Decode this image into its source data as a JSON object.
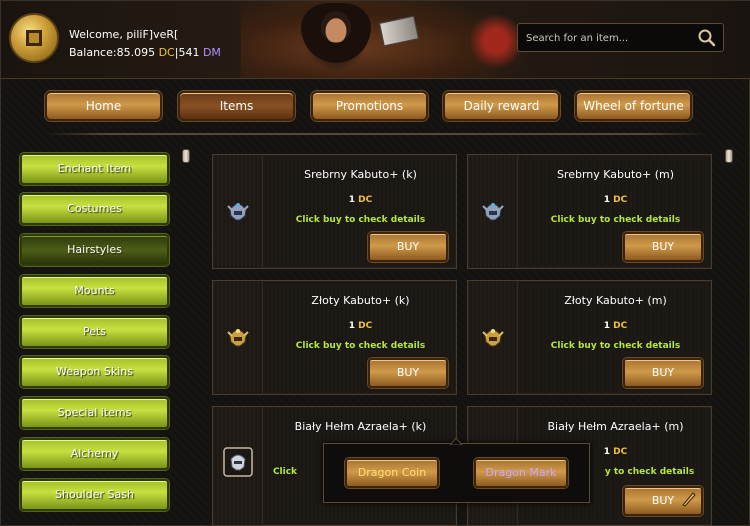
{
  "header": {
    "welcome_prefix": "Welcome, ",
    "username": "piliF]veR[",
    "balance_label": "Balance:",
    "dc_amount": "85.095",
    "dc_unit": "DC",
    "separator": "|",
    "dm_amount": "541",
    "dm_unit": "DM"
  },
  "search": {
    "placeholder": "Search for an item..."
  },
  "nav": {
    "items": [
      {
        "label": "Home"
      },
      {
        "label": "Items"
      },
      {
        "label": "Promotions"
      },
      {
        "label": "Daily reward"
      },
      {
        "label": "Wheel of fortune"
      }
    ],
    "active": "Items"
  },
  "sidebar": {
    "items": [
      {
        "label": "Enchant Item"
      },
      {
        "label": "Costumes"
      },
      {
        "label": "Hairstyles"
      },
      {
        "label": "Mounts"
      },
      {
        "label": "Pets"
      },
      {
        "label": "Weapon Skins"
      },
      {
        "label": "Special items"
      },
      {
        "label": "Alchemy"
      },
      {
        "label": "Shoulder Sash"
      }
    ],
    "active": "Hairstyles"
  },
  "items": [
    {
      "name": "Srebrny Kabuto+ (k)",
      "price": "1",
      "currency": "DC",
      "hint": "Click buy to check details",
      "buy": "BUY",
      "icon": "silver-helmet-icon"
    },
    {
      "name": "Srebrny Kabuto+ (m)",
      "price": "1",
      "currency": "DC",
      "hint": "Click buy to check details",
      "buy": "BUY",
      "icon": "silver-helmet-icon"
    },
    {
      "name": "Złoty Kabuto+ (k)",
      "price": "1",
      "currency": "DC",
      "hint": "Click buy to check details",
      "buy": "BUY",
      "icon": "gold-helmet-icon"
    },
    {
      "name": "Złoty Kabuto+ (m)",
      "price": "1",
      "currency": "DC",
      "hint": "Click buy to check details",
      "buy": "BUY",
      "icon": "gold-helmet-icon"
    },
    {
      "name": "Biały Hełm Azraela+ (k)",
      "price": "",
      "currency": "",
      "hint": "Click",
      "buy": "",
      "icon": "white-helmet-icon"
    },
    {
      "name": "Biały Hełm Azraela+ (m)",
      "price": "1",
      "currency": "DC",
      "hint": "y to check details",
      "buy": "BUY",
      "icon": "white-helmet-icon"
    }
  ],
  "currency_popup": {
    "coin_label": "Dragon Coin",
    "mark_label": "Dragon Mark"
  },
  "colors": {
    "dc": "#f0c040",
    "dm": "#b090ff",
    "hint": "#b6e83c",
    "nav_button": "#c08a40",
    "sidebar_button": "#b4d034"
  }
}
